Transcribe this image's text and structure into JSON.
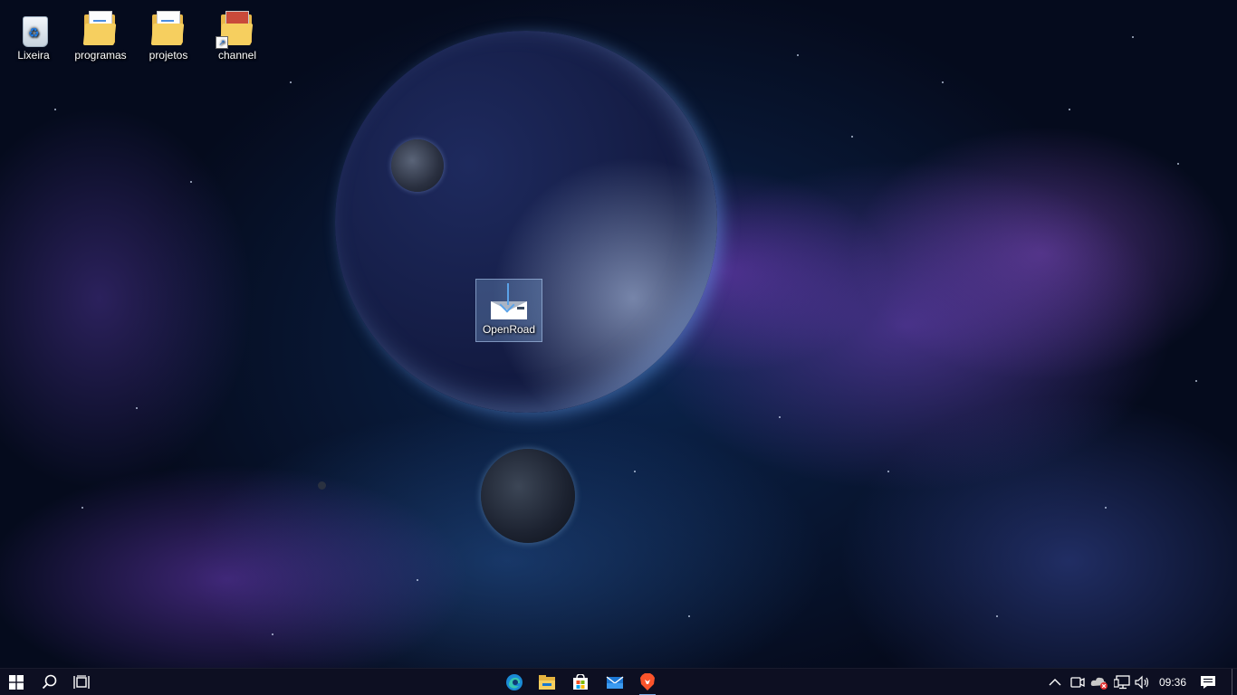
{
  "desktop": {
    "icons": [
      {
        "label": "Lixeira"
      },
      {
        "label": "programas"
      },
      {
        "label": "projetos"
      },
      {
        "label": "channel"
      },
      {
        "label": "OpenRoad"
      }
    ]
  },
  "taskbar": {
    "clock": "09:36",
    "pinned_apps": [
      {
        "name": "edge-icon"
      },
      {
        "name": "file-explorer-icon"
      },
      {
        "name": "microsoft-store-icon"
      },
      {
        "name": "mail-icon"
      },
      {
        "name": "brave-browser-icon"
      }
    ]
  },
  "colors": {
    "taskbar": "#0e1022",
    "active_indicator": "#7aa7e0",
    "folder": "#f6cf5f",
    "brave": "#fb542b"
  }
}
